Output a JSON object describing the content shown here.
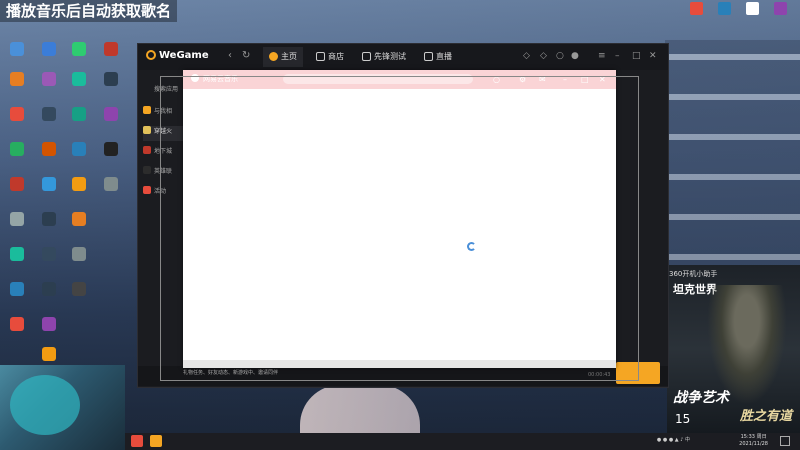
{
  "stream_title": "播放音乐后自动获取歌名",
  "wegame": {
    "logo": "WeGame",
    "tabs": [
      {
        "label": "主页",
        "active": true
      },
      {
        "label": "商店",
        "active": false
      },
      {
        "label": "先锋测试",
        "active": false
      },
      {
        "label": "直播",
        "active": false
      }
    ],
    "sidebar": [
      {
        "label": "搜索应用",
        "color": "#444"
      },
      {
        "label": "与我相",
        "color": "#f5a623"
      },
      {
        "label": "穿越火",
        "color": "#e2c15a",
        "active": true
      },
      {
        "label": "地下城",
        "color": "#c0392b"
      },
      {
        "label": "英雄联",
        "color": "#2c2c2c"
      },
      {
        "label": "活动",
        "color": "#e74c3c"
      }
    ],
    "status_text": "礼物任务、好友动态、新游戏中、邀请同伴",
    "bottom_time": "00:00:43",
    "accent": "#f5a623"
  },
  "music_app": {
    "title": "网易云音乐",
    "header_color": "#fad4d6"
  },
  "taskbar": {
    "time": "15:33 周日",
    "date": "2021/11/28"
  },
  "ad": {
    "tag": "360开机小助手",
    "logo": "坦克世界",
    "title1": "战争艺术",
    "title2": "胜之有道",
    "number": "15"
  }
}
